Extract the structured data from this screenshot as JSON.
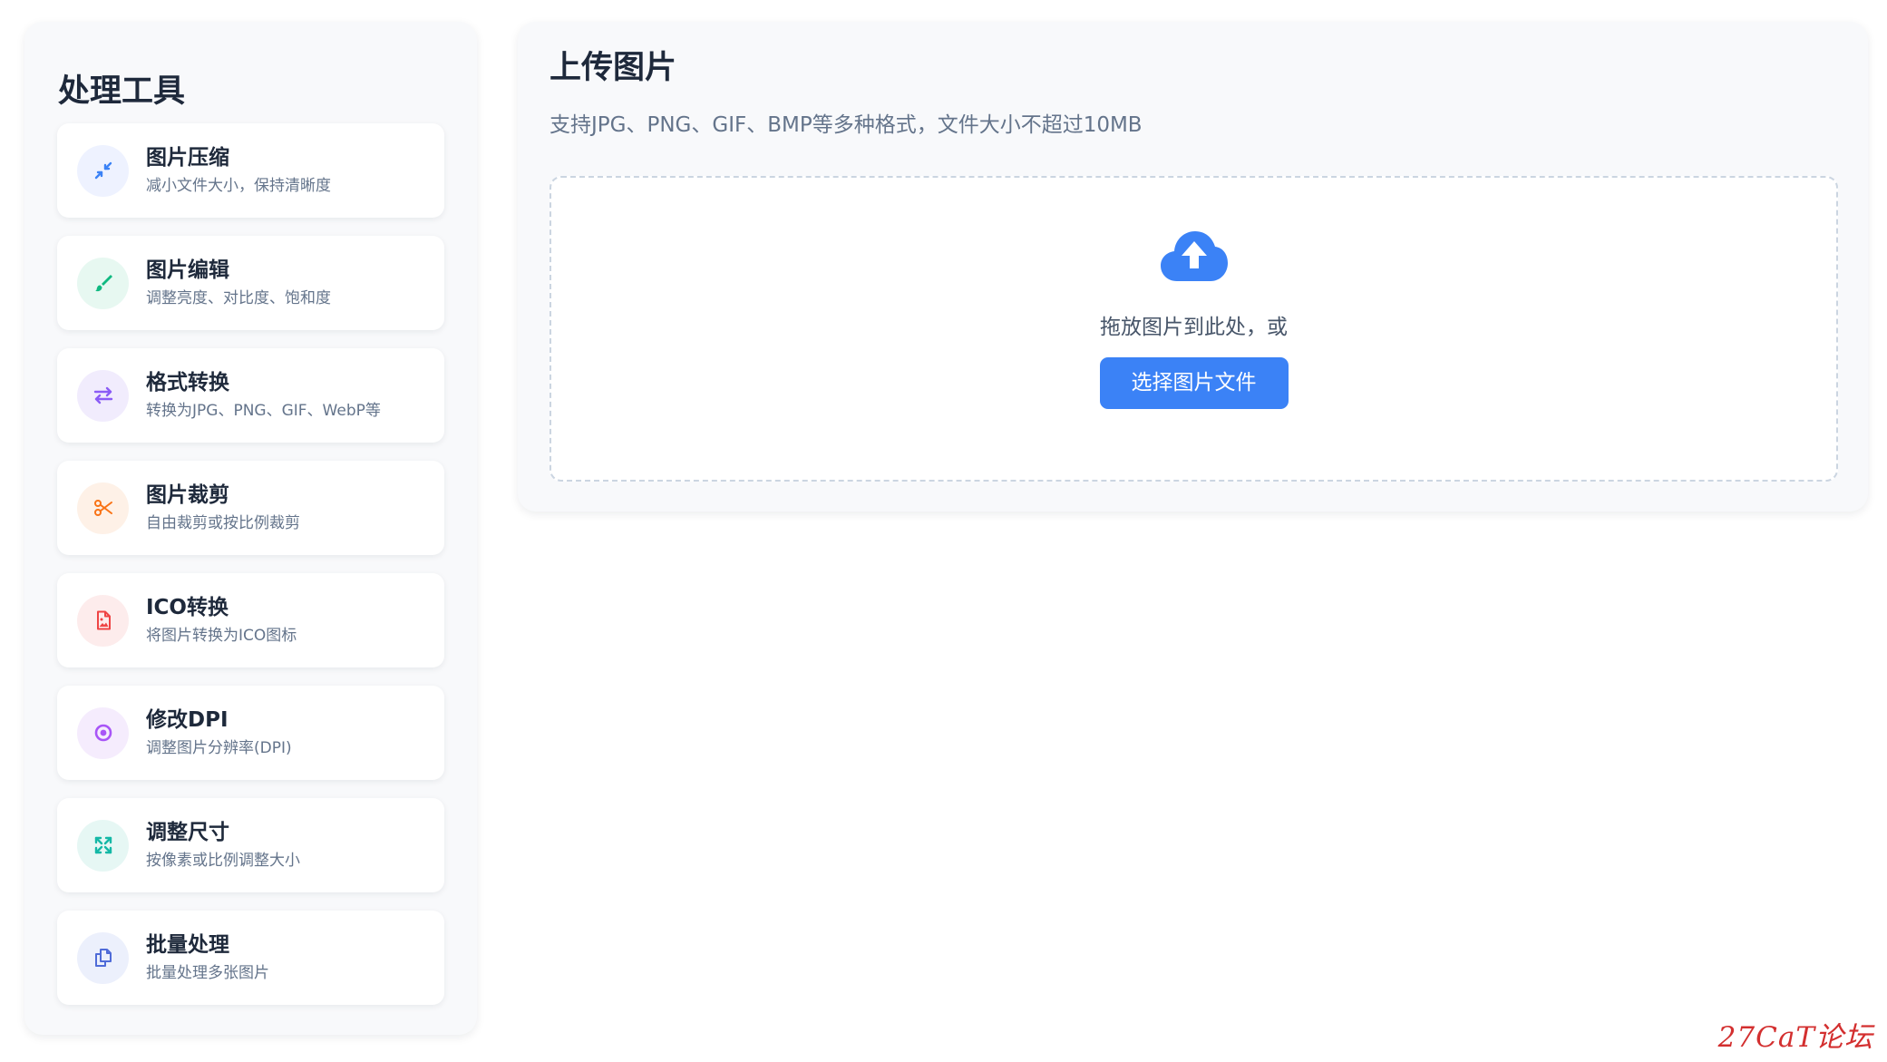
{
  "sidebar": {
    "title": "处理工具",
    "tools": [
      {
        "name": "图片压缩",
        "desc": "减小文件大小，保持清晰度",
        "icon": "compress-icon",
        "color": "#3b82f6",
        "bg": "#eef2ff"
      },
      {
        "name": "图片编辑",
        "desc": "调整亮度、对比度、饱和度",
        "icon": "brush-icon",
        "color": "#10b981",
        "bg": "#e7f8f1"
      },
      {
        "name": "格式转换",
        "desc": "转换为JPG、PNG、GIF、WebP等",
        "icon": "exchange-icon",
        "color": "#8b5cf6",
        "bg": "#f1ecfd"
      },
      {
        "name": "图片裁剪",
        "desc": "自由裁剪或按比例裁剪",
        "icon": "scissors-icon",
        "color": "#f97316",
        "bg": "#fef1e7"
      },
      {
        "name": "ICO转换",
        "desc": "将图片转换为ICO图标",
        "icon": "image-file-icon",
        "color": "#ef4444",
        "bg": "#fdecec"
      },
      {
        "name": "修改DPI",
        "desc": "调整图片分辨率(DPI)",
        "icon": "dpi-target-icon",
        "color": "#a855f7",
        "bg": "#f5ecfd"
      },
      {
        "name": "调整尺寸",
        "desc": "按像素或比例调整大小",
        "icon": "expand-icon",
        "color": "#14b8a6",
        "bg": "#e6f7f4"
      },
      {
        "name": "批量处理",
        "desc": "批量处理多张图片",
        "icon": "copy-icon",
        "color": "#4f6bd8",
        "bg": "#ecf0fc"
      }
    ]
  },
  "main": {
    "title": "上传图片",
    "subtitle": "支持JPG、PNG、GIF、BMP等多种格式，文件大小不超过10MB",
    "drop_text": "拖放图片到此处，或",
    "button_label": "选择图片文件",
    "upload_icon": "cloud-upload-icon",
    "accent_color": "#3b82f6"
  },
  "watermark": "27CaT论坛"
}
